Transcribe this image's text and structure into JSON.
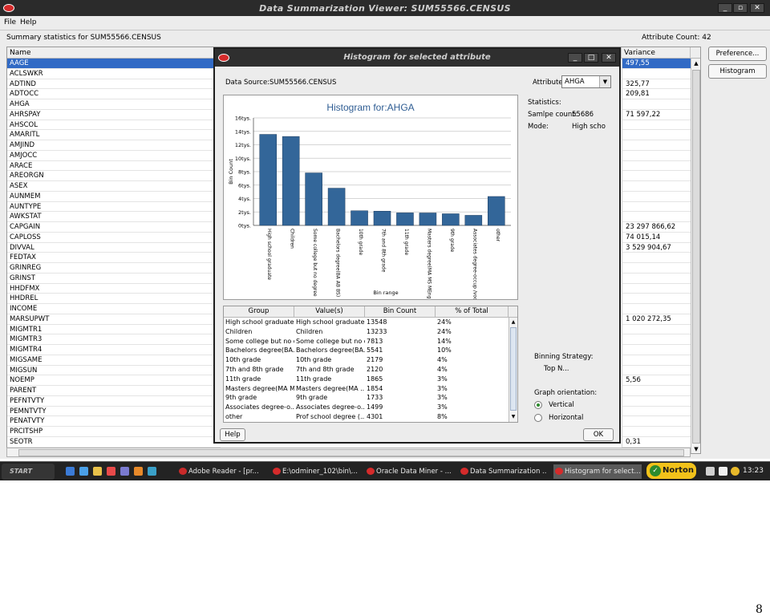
{
  "window": {
    "title": "Data Summarization Viewer: SUM55566.CENSUS"
  },
  "menu": {
    "file": "File",
    "help": "Help"
  },
  "summary": {
    "label": "Summary statistics for SUM55566.CENSUS",
    "attribute_count": "Attribute Count: 42",
    "columns": {
      "name": "Name",
      "variance": "Variance"
    },
    "rows": [
      {
        "name": "AAGE",
        "variance": "497,55"
      },
      {
        "name": "ACLSWKR",
        "variance": ""
      },
      {
        "name": "ADTIND",
        "variance": "325,77"
      },
      {
        "name": "ADTOCC",
        "variance": "209,81"
      },
      {
        "name": "AHGA",
        "variance": ""
      },
      {
        "name": "AHRSPAY",
        "variance": "71 597,22"
      },
      {
        "name": "AHSCOL",
        "variance": ""
      },
      {
        "name": "AMARITL",
        "variance": ""
      },
      {
        "name": "AMJIND",
        "variance": ""
      },
      {
        "name": "AMJOCC",
        "variance": ""
      },
      {
        "name": "ARACE",
        "variance": ""
      },
      {
        "name": "AREORGN",
        "variance": ""
      },
      {
        "name": "ASEX",
        "variance": ""
      },
      {
        "name": "AUNMEM",
        "variance": ""
      },
      {
        "name": "AUNTYPE",
        "variance": ""
      },
      {
        "name": "AWKSTAT",
        "variance": ""
      },
      {
        "name": "CAPGAIN",
        "variance": "23 297 866,62"
      },
      {
        "name": "CAPLOSS",
        "variance": "74 015,14"
      },
      {
        "name": "DIVVAL",
        "variance": "3 529 904,67"
      },
      {
        "name": "FEDTAX",
        "variance": ""
      },
      {
        "name": "GRINREG",
        "variance": ""
      },
      {
        "name": "GRINST",
        "variance": ""
      },
      {
        "name": "HHDFMX",
        "variance": ""
      },
      {
        "name": "HHDREL",
        "variance": ""
      },
      {
        "name": "INCOME",
        "variance": ""
      },
      {
        "name": "MARSUPWT",
        "variance": "1 020 272,35"
      },
      {
        "name": "MIGMTR1",
        "variance": ""
      },
      {
        "name": "MIGMTR3",
        "variance": ""
      },
      {
        "name": "MIGMTR4",
        "variance": ""
      },
      {
        "name": "MIGSAME",
        "variance": ""
      },
      {
        "name": "MIGSUN",
        "variance": ""
      },
      {
        "name": "NOEMP",
        "variance": "5,56"
      },
      {
        "name": "PARENT",
        "variance": ""
      },
      {
        "name": "PEFNTVTY",
        "variance": ""
      },
      {
        "name": "PEMNTVTY",
        "variance": ""
      },
      {
        "name": "PENATVTY",
        "variance": ""
      },
      {
        "name": "PRCITSHP",
        "variance": ""
      },
      {
        "name": "SEOTR",
        "variance": "0,31"
      }
    ],
    "selected_index": 0
  },
  "side_buttons": {
    "preference": "Preference...",
    "histogram": "Histogram"
  },
  "dialog": {
    "title": "Histogram for selected attribute",
    "data_source": "Data Source:SUM55566.CENSUS",
    "attribute_label": "Attribute:",
    "attribute_value": "AHGA",
    "statistics_label": "Statistics:",
    "sample_count_label": "Samlpe count:",
    "sample_count_value": "55686",
    "mode_label": "Mode:",
    "mode_value": "High scho",
    "binning_label": "Binning Strategy:",
    "binning_value": "Top N...",
    "orientation_label": "Graph orientation:",
    "orientation_vertical": "Vertical",
    "orientation_horizontal": "Horizontal",
    "orientation_selected": "Vertical",
    "help_button": "Help",
    "ok_button": "OK",
    "grid": {
      "columns": [
        "Group",
        "Value(s)",
        "Bin Count",
        "% of Total"
      ],
      "rows": [
        [
          "High school graduate",
          "High school graduate",
          "13548",
          "24%"
        ],
        [
          "Children",
          "Children",
          "13233",
          "24%"
        ],
        [
          "Some college but no d...",
          "Some college but no d...",
          "7813",
          "14%"
        ],
        [
          "Bachelors degree(BA...",
          "Bachelors degree(BA...",
          "5541",
          "10%"
        ],
        [
          "10th grade",
          "10th grade",
          "2179",
          "4%"
        ],
        [
          "7th and 8th grade",
          "7th and 8th grade",
          "2120",
          "4%"
        ],
        [
          "11th grade",
          "11th grade",
          "1865",
          "3%"
        ],
        [
          "Masters degree(MA M...",
          "Masters degree(MA ...",
          "1854",
          "3%"
        ],
        [
          "9th grade",
          "9th grade",
          "1733",
          "3%"
        ],
        [
          "Associates degree-o...",
          "Associates degree-o...",
          "1499",
          "3%"
        ],
        [
          "other",
          "Prof school degree (...",
          "4301",
          "8%"
        ]
      ]
    }
  },
  "chart_data": {
    "type": "bar",
    "title": "Histogram for:AHGA",
    "xlabel": "Bin range",
    "ylabel": "Bin Count",
    "ylim": [
      0,
      16000
    ],
    "yticks": [
      "0tys.",
      "2tys.",
      "4tys.",
      "6tys.",
      "8tys.",
      "10tys.",
      "12tys.",
      "14tys.",
      "16tys."
    ],
    "categories": [
      "High school graduate",
      "Children",
      "Some college but no degree",
      "Bachelors degree(BA AB BS)",
      "10th grade",
      "7th and 8th grade",
      "11th grade",
      "Masters degree(MA MS MEng MEd MSW MBA)",
      "9th grade",
      "Associates degree-occup /vocational",
      "other"
    ],
    "values": [
      13548,
      13233,
      7813,
      5541,
      2179,
      2120,
      1865,
      1854,
      1733,
      1499,
      4301
    ],
    "bar_color": "#336699",
    "grid": true,
    "legend": "none"
  },
  "taskbar": {
    "start": "START",
    "tasks": [
      "Adobe Reader - [pr...",
      "E:\\odminer_102\\bin\\...",
      "Oracle Data Miner - ...",
      "Data Summarization ...",
      "Histogram for select..."
    ],
    "active_task": 4,
    "norton": "Norton",
    "clock": "13:23"
  },
  "page_number": "8"
}
